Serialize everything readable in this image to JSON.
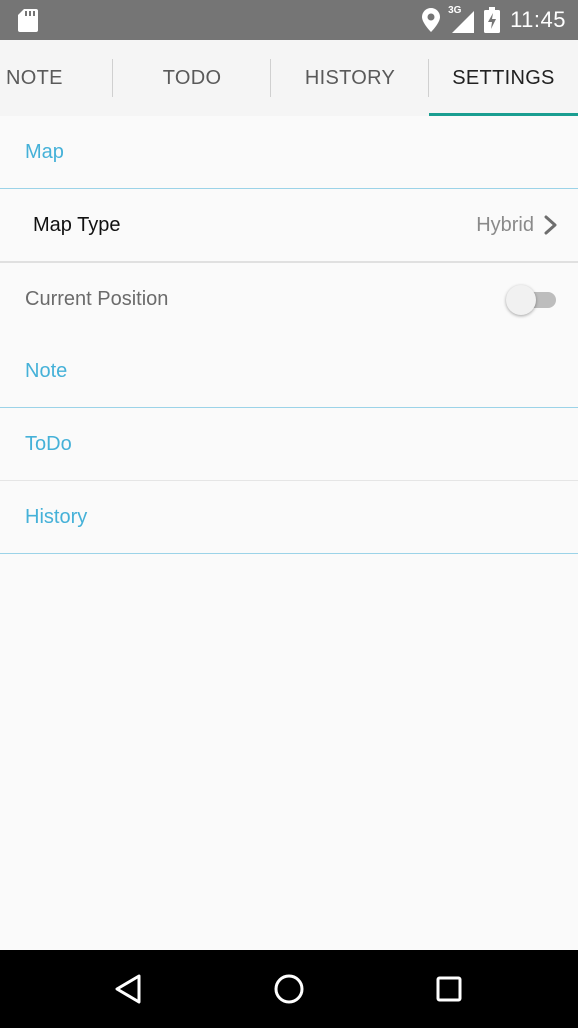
{
  "status_bar": {
    "network_label": "3G",
    "time": "11:45",
    "icons": [
      "sd-card-icon",
      "location-icon",
      "signal-icon",
      "battery-icon"
    ]
  },
  "tabs": [
    {
      "label": "NOTE",
      "selected": false
    },
    {
      "label": "TODO",
      "selected": false
    },
    {
      "label": "HISTORY",
      "selected": false
    },
    {
      "label": "SETTINGS",
      "selected": true
    }
  ],
  "settings": {
    "map_header": "Map",
    "map_type": {
      "title": "Map Type",
      "value": "Hybrid"
    },
    "current_position": {
      "title": "Current Position",
      "enabled": false
    },
    "note_header": "Note",
    "todo_header": "ToDo",
    "history_header": "History"
  },
  "colors": {
    "accent": "#1a9e91",
    "section_header": "#45b1d8",
    "status_bar": "#757575",
    "nav_bar": "#000000"
  },
  "nav_bar": {
    "icons": [
      "back-icon",
      "home-icon",
      "recents-icon"
    ]
  }
}
